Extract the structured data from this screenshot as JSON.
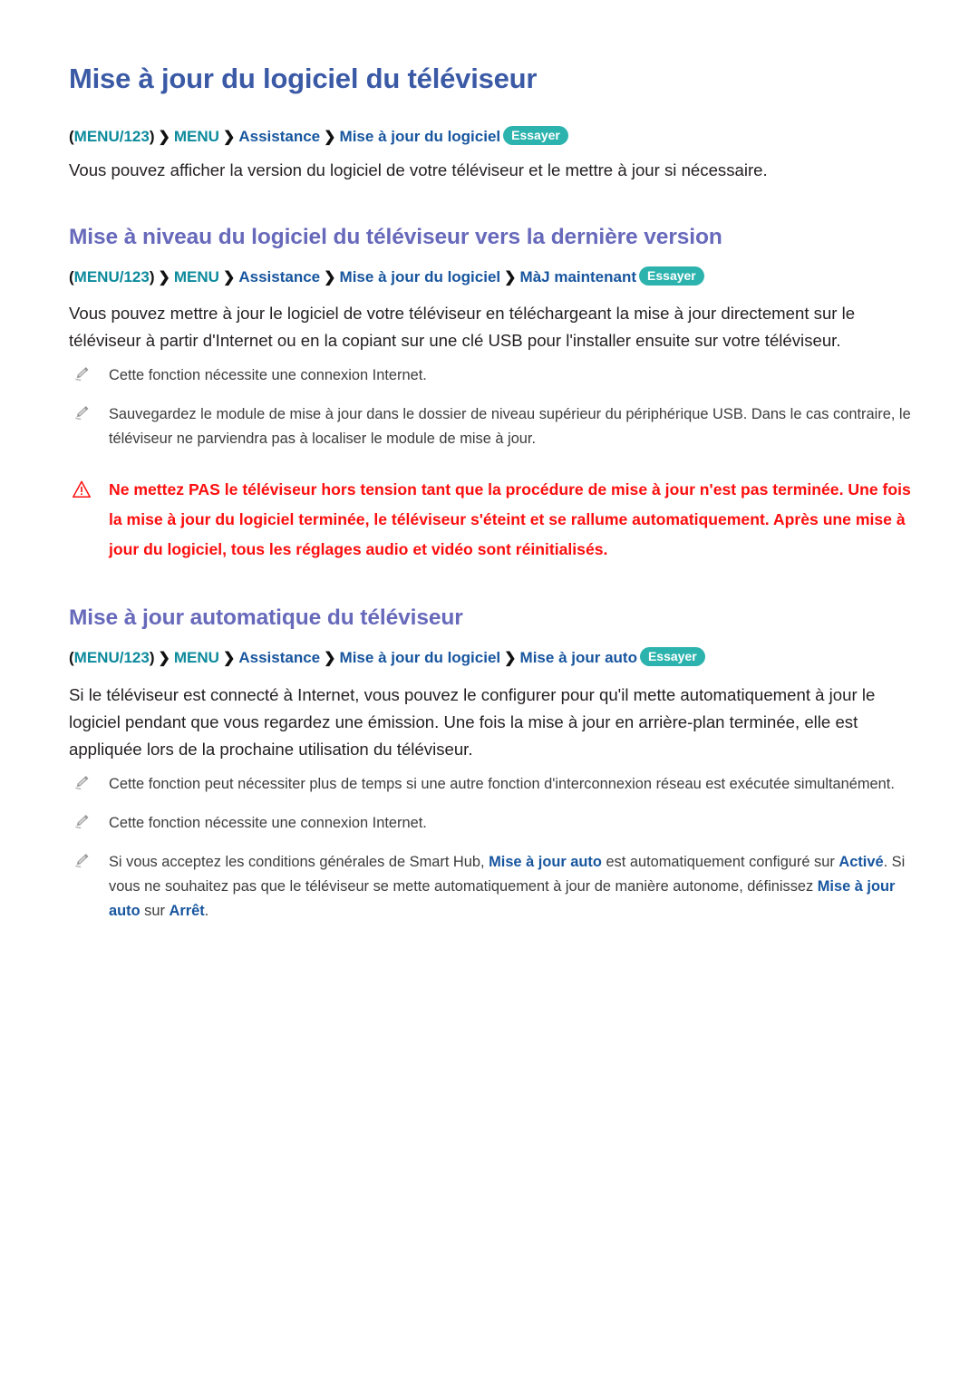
{
  "page": {
    "title": "Mise à jour du logiciel du téléviseur"
  },
  "breadcrumbs": {
    "menu123": "MENU/123",
    "menu": "MENU",
    "assistance": "Assistance",
    "software_update": "Mise à jour du logiciel",
    "update_now": "MàJ maintenant",
    "auto_update": "Mise à jour auto",
    "separator": "❯",
    "paren_open": "(",
    "paren_close": ")",
    "try_label": "Essayer"
  },
  "intro": {
    "paragraph": "Vous pouvez afficher la version du logiciel de votre téléviseur et le mettre à jour si nécessaire."
  },
  "section_upgrade": {
    "heading": "Mise à niveau du logiciel du téléviseur vers la dernière version",
    "paragraph": "Vous pouvez mettre à jour le logiciel de votre téléviseur en téléchargeant la mise à jour directement sur le téléviseur à partir d'Internet ou en la copiant sur une clé USB pour l'installer ensuite sur votre téléviseur.",
    "notes": [
      "Cette fonction nécessite une connexion Internet.",
      "Sauvegardez le module de mise à jour dans le dossier de niveau supérieur du périphérique USB. Dans le cas contraire, le téléviseur ne parviendra pas à localiser le module de mise à jour."
    ],
    "caution": "Ne mettez PAS le téléviseur hors tension tant que la procédure de mise à jour n'est pas terminée. Une fois la mise à jour du logiciel terminée, le téléviseur s'éteint et se rallume automatiquement. Après une mise à jour du logiciel, tous les réglages audio et vidéo sont réinitialisés."
  },
  "section_auto": {
    "heading": "Mise à jour automatique du téléviseur",
    "paragraph": "Si le téléviseur est connecté à Internet, vous pouvez le configurer pour qu'il mette automatiquement à jour le logiciel pendant que vous regardez une émission. Une fois la mise à jour en arrière-plan terminée, elle est appliquée lors de la prochaine utilisation du téléviseur.",
    "notes": [
      "Cette fonction peut nécessiter plus de temps si une autre fonction d'interconnexion réseau est exécutée simultanément.",
      "Cette fonction nécessite une connexion Internet."
    ],
    "note_smarthub": {
      "part1": "Si vous acceptez les conditions générales de Smart Hub, ",
      "kw1": "Mise à jour auto",
      "part2": " est automatiquement configuré sur ",
      "kw2": "Activé",
      "part3": ". Si vous ne souhaitez pas que le téléviseur se mette automatiquement à jour de manière autonome, définissez ",
      "kw3": "Mise à jour auto",
      "part4": " sur ",
      "kw4": "Arrêt",
      "part5": "."
    }
  },
  "colors": {
    "title_blue": "#3b5aa6",
    "heading_violet": "#6769bb",
    "breadcrumb_teal": "#0c8a9c",
    "breadcrumb_blue": "#17559e",
    "badge_teal": "#2cb3ae",
    "caution_red": "#fd0d0d",
    "body_text": "#231f20",
    "note_text": "#3c3c3c"
  },
  "icons": {
    "pencil": "pencil-icon",
    "warning": "warning-triangle-icon"
  }
}
